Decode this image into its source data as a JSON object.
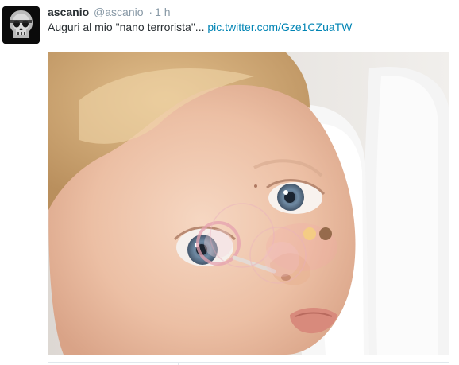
{
  "tweet": {
    "user": {
      "name": "ascanio",
      "handle": "@ascanio",
      "avatar_icon": "skull-avatar-icon"
    },
    "separator": "·",
    "time": "1 h",
    "text_before_link": "Auguri al mio \"nano terrorista\"... ",
    "link_text": "pic.twitter.com/Gze1CZuaTW",
    "media": {
      "kind": "photo",
      "description_icon": "baby-photo"
    }
  },
  "colors": {
    "name": "#292f33",
    "meta": "#8899a6",
    "link": "#0084b4",
    "divider": "#e1e8ed"
  }
}
